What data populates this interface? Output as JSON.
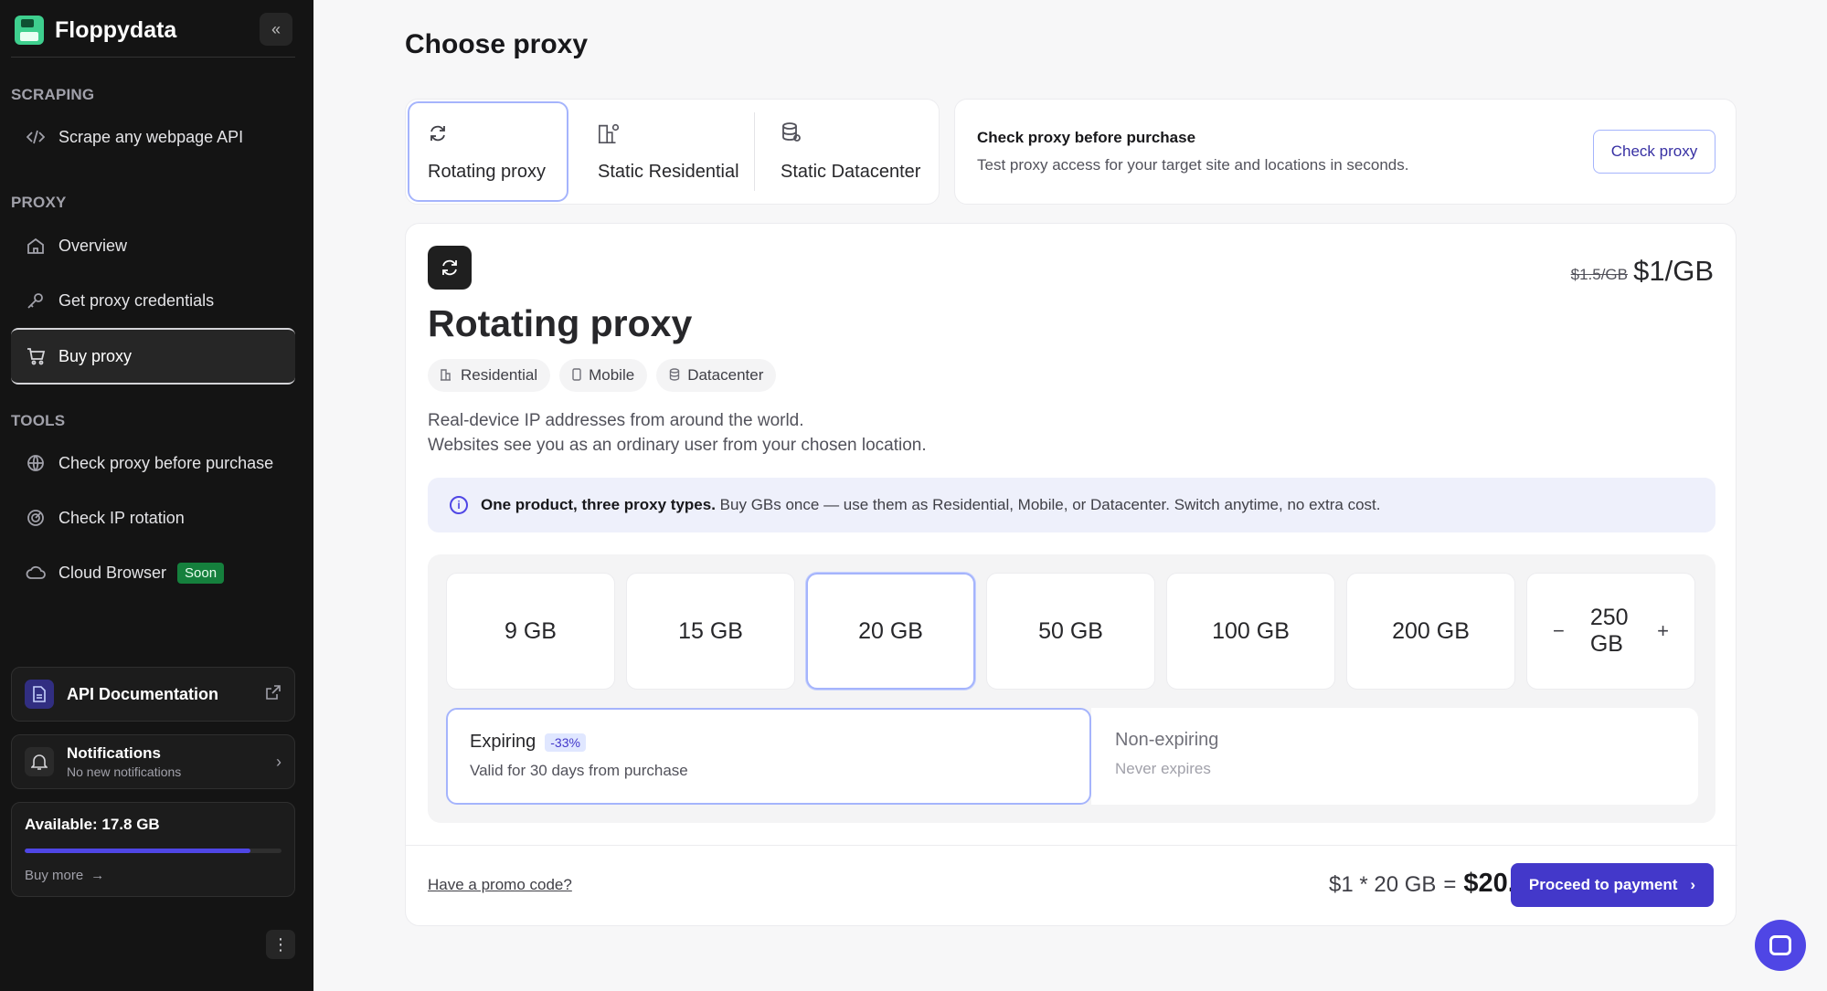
{
  "app": {
    "name": "Floppydata"
  },
  "sidebar": {
    "sections": {
      "scraping": "SCRAPING",
      "proxy": "PROXY",
      "tools": "TOOLS"
    },
    "items": {
      "scrape_api": "Scrape any webpage API",
      "overview": "Overview",
      "get_credentials": "Get proxy credentials",
      "buy_proxy": "Buy proxy",
      "check_proxy": "Check proxy before purchase",
      "check_ip_rotation": "Check IP rotation",
      "cloud_browser": "Cloud Browser",
      "cloud_browser_badge": "Soon"
    },
    "api_doc": "API Documentation",
    "notifications": {
      "title": "Notifications",
      "subtitle": "No new notifications"
    },
    "available": {
      "label": "Available: 17.8 GB",
      "fill_fraction": 0.88
    },
    "buy_more": "Buy more"
  },
  "page": {
    "title": "Choose proxy"
  },
  "tabs": {
    "rotating": "Rotating proxy",
    "static_residential": "Static Residential",
    "static_datacenter": "Static Datacenter"
  },
  "check_card": {
    "title": "Check proxy before purchase",
    "subtitle": "Test proxy access for your target site and locations in seconds.",
    "button": "Check proxy"
  },
  "product": {
    "title": "Rotating proxy",
    "old_price": "$1.5/GB",
    "price": "$1/GB",
    "chips": {
      "residential": "Residential",
      "mobile": "Mobile",
      "datacenter": "Datacenter"
    },
    "desc_line1": "Real-device IP addresses from around the world.",
    "desc_line2": "Websites see you as an ordinary user from your chosen location.",
    "info_bold": "One product, three proxy types.",
    "info_rest": " Buy GBs once — use them as Residential, Mobile, or Datacenter. Switch anytime, no extra cost."
  },
  "gb_options": {
    "o1": "9 GB",
    "o2": "15 GB",
    "o3": "20 GB",
    "o4": "50 GB",
    "o5": "100 GB",
    "o6": "200 GB",
    "custom": "250 GB",
    "minus": "−",
    "plus": "+"
  },
  "plans": {
    "expiring": {
      "title": "Expiring",
      "badge": "-33%",
      "subtitle": "Valid for 30 days from purchase"
    },
    "nonexpiring": {
      "title": "Non-expiring",
      "subtitle": "Never expires"
    }
  },
  "footer": {
    "promo": "Have a promo code?",
    "expr": "$1 * 20 GB",
    "eq": "=",
    "total": "$20.0",
    "pay_button": "Proceed to payment"
  },
  "colors": {
    "accent": "#4338ca",
    "sidebar_bg": "#141414",
    "soon_badge": "#15803d",
    "selected_border": "#a5b4fc"
  }
}
